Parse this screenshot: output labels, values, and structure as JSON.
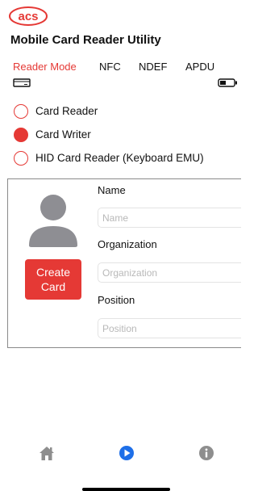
{
  "app": {
    "logo_text": "acs",
    "title": "Mobile Card Reader Utility"
  },
  "tabs": [
    {
      "label": "Reader Mode",
      "active": true
    },
    {
      "label": "NFC",
      "active": false
    },
    {
      "label": "NDEF",
      "active": false
    },
    {
      "label": "APDU",
      "active": false
    }
  ],
  "status_icons": [
    "card-reader-icon",
    "battery-icon"
  ],
  "modes": [
    {
      "label": "Card Reader",
      "selected": false
    },
    {
      "label": "Card Writer",
      "selected": true
    },
    {
      "label": "HID Card Reader (Keyboard EMU)",
      "selected": false
    }
  ],
  "card_writer": {
    "avatar_icon": "person-icon",
    "create_button": "Create\nCard",
    "fields": [
      {
        "label": "Name",
        "placeholder": "Name",
        "value": ""
      },
      {
        "label": "Organization",
        "placeholder": "Organization",
        "value": ""
      },
      {
        "label": "Position",
        "placeholder": "Position",
        "value": ""
      }
    ]
  },
  "bottom_nav": [
    {
      "icon": "home-icon",
      "active": false
    },
    {
      "icon": "play-circle-icon",
      "active": true
    },
    {
      "icon": "info-icon",
      "active": false
    }
  ],
  "colors": {
    "accent": "#e53935",
    "inactive_icon": "#8e8e8e",
    "active_icon": "#1e6fe8"
  }
}
